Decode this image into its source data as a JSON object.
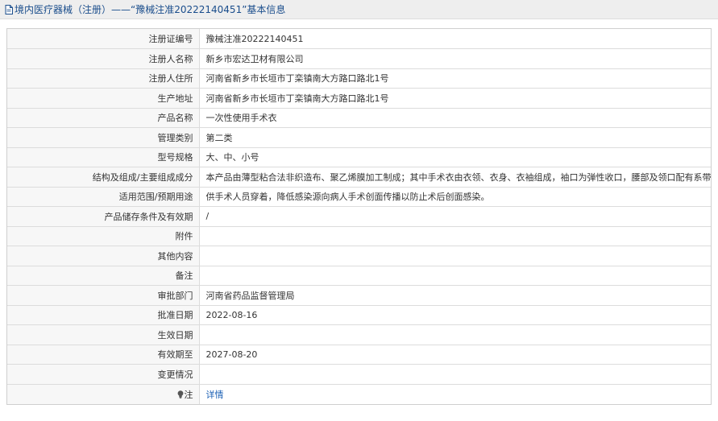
{
  "header": {
    "title": "境内医疗器械（注册）——“豫械注准20222140451”基本信息"
  },
  "rows": [
    {
      "label": "注册证编号",
      "value": "豫械注准20222140451"
    },
    {
      "label": "注册人名称",
      "value": "新乡市宏达卫材有限公司"
    },
    {
      "label": "注册人住所",
      "value": "河南省新乡市长垣市丁栾镇南大方路口路北1号"
    },
    {
      "label": "生产地址",
      "value": "河南省新乡市长垣市丁栾镇南大方路口路北1号"
    },
    {
      "label": "产品名称",
      "value": "一次性使用手术衣"
    },
    {
      "label": "管理类别",
      "value": "第二类"
    },
    {
      "label": "型号规格",
      "value": "大、中、小号"
    },
    {
      "label": "结构及组成/主要组成成分",
      "value": "本产品由薄型粘合法非织造布、聚乙烯膜加工制成；其中手术衣由衣领、衣身、衣袖组成，袖口为弹性收口，腰部及领口配有系带。"
    },
    {
      "label": "适用范围/预期用途",
      "value": "供手术人员穿着，降低感染源向病人手术创面传播以防止术后创面感染。"
    },
    {
      "label": "产品储存条件及有效期",
      "value": "/"
    },
    {
      "label": "附件",
      "value": ""
    },
    {
      "label": "其他内容",
      "value": ""
    },
    {
      "label": "备注",
      "value": ""
    },
    {
      "label": "审批部门",
      "value": "河南省药品监督管理局"
    },
    {
      "label": "批准日期",
      "value": "2022-08-16"
    },
    {
      "label": "生效日期",
      "value": ""
    },
    {
      "label": "有效期至",
      "value": "2027-08-20"
    },
    {
      "label": "变更情况",
      "value": ""
    }
  ],
  "note": {
    "label": "注",
    "icon": "lightbulb-icon",
    "link_text": "详情"
  },
  "colors": {
    "header_bg": "#eeeeee",
    "header_text": "#1a4d8c",
    "label_bg": "#f7f7f7",
    "border": "#dcdcdc",
    "link": "#1a5fb4"
  }
}
